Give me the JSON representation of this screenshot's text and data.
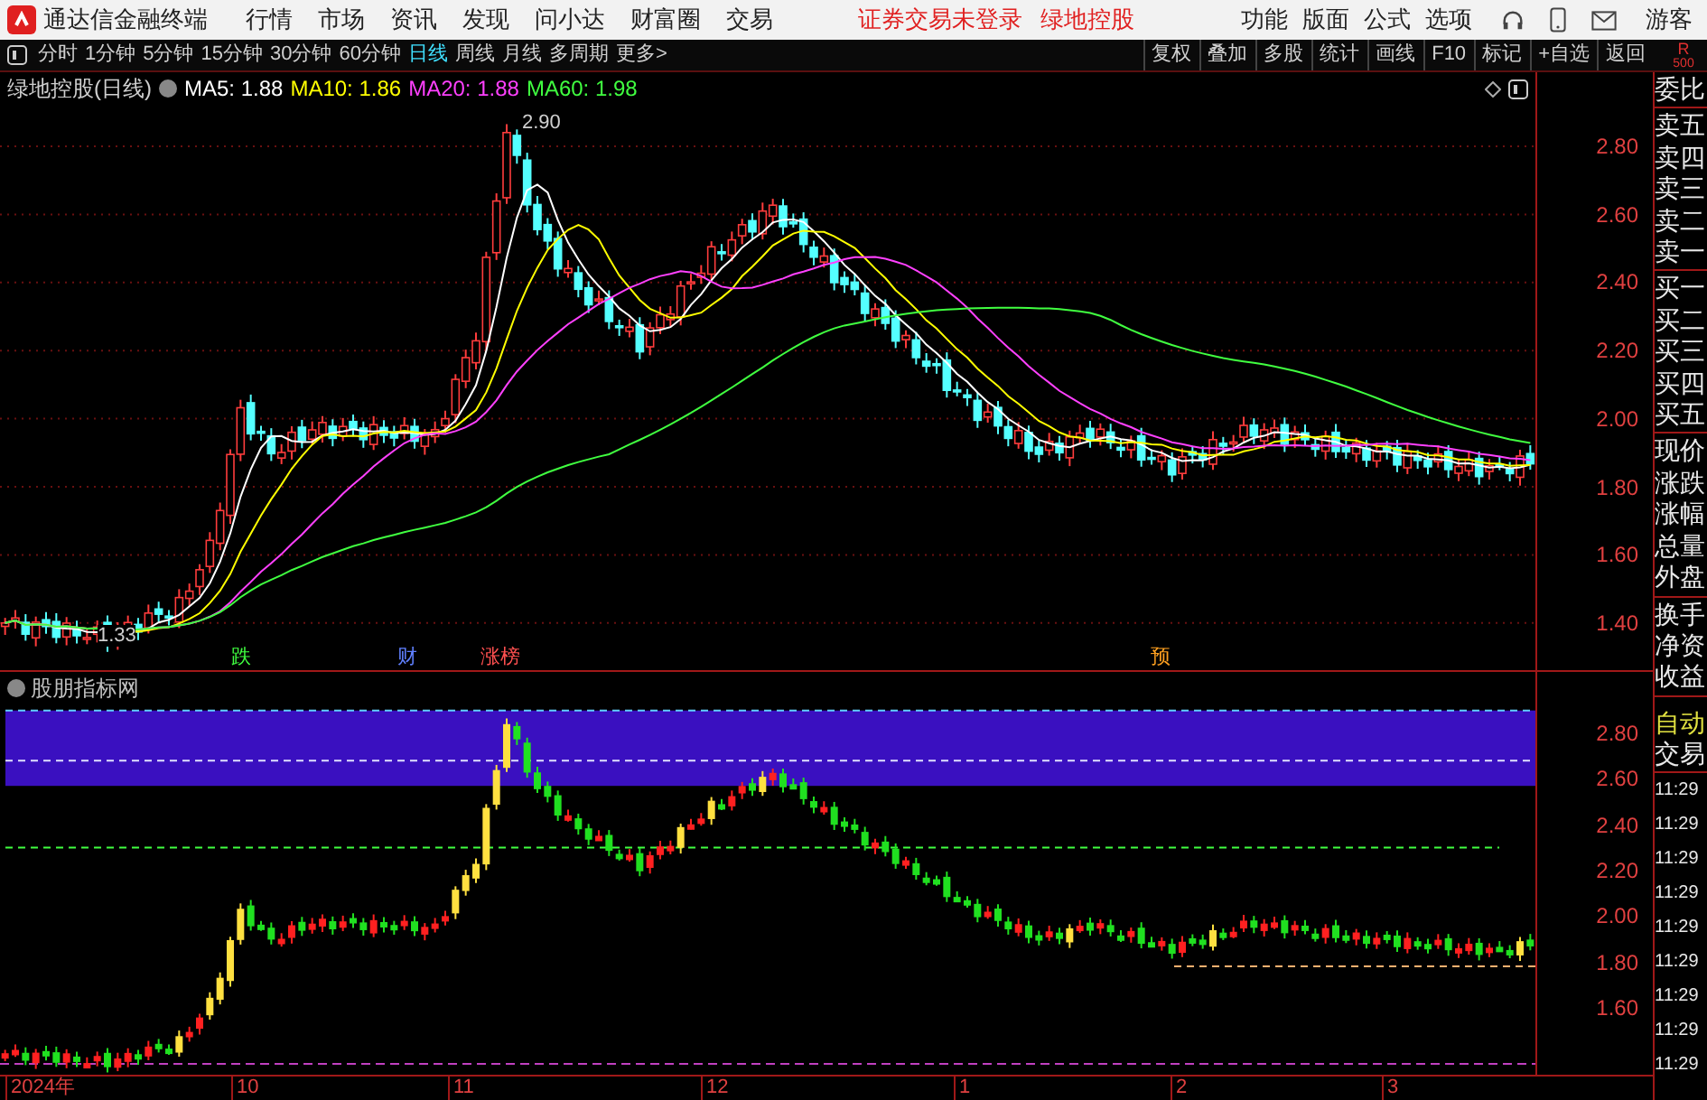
{
  "title_bar": {
    "app_name": "通达信金融终端",
    "menus": [
      "行情",
      "市场",
      "资讯",
      "发现",
      "问小达",
      "财富圈",
      "交易"
    ],
    "notices": [
      "证券交易未登录",
      "绿地控股"
    ],
    "tools": [
      "功能",
      "版面",
      "公式",
      "选项"
    ],
    "user": "游客"
  },
  "toolbar": {
    "periods": [
      {
        "label": "分时",
        "selected": false
      },
      {
        "label": "1分钟",
        "selected": false
      },
      {
        "label": "5分钟",
        "selected": false
      },
      {
        "label": "15分钟",
        "selected": false
      },
      {
        "label": "30分钟",
        "selected": false
      },
      {
        "label": "60分钟",
        "selected": false
      },
      {
        "label": "日线",
        "selected": true
      },
      {
        "label": "周线",
        "selected": false
      },
      {
        "label": "月线",
        "selected": false
      },
      {
        "label": "多周期",
        "selected": false
      },
      {
        "label": "更多>",
        "selected": false
      }
    ],
    "actions": [
      "复权",
      "叠加",
      "多股",
      "统计",
      "画线",
      "F10",
      "标记",
      "+自选",
      "返回"
    ],
    "corner": [
      "R",
      "500"
    ]
  },
  "main_chart": {
    "title": "绿地控股(日线)",
    "moving_averages": [
      {
        "label": "MA5: 1.88",
        "color": "#ffffff"
      },
      {
        "label": "MA10: 1.86",
        "color": "#ffff00"
      },
      {
        "label": "MA20: 1.88",
        "color": "#ff40ff"
      },
      {
        "label": "MA60: 1.98",
        "color": "#40ff40"
      }
    ],
    "y_ticks": [
      "2.80",
      "2.60",
      "2.40",
      "2.20",
      "2.00",
      "1.80",
      "1.60",
      "1.40"
    ],
    "high_label": "2.90",
    "low_label": "1.33",
    "markers": [
      {
        "text": "跌",
        "color": "#40ff40"
      },
      {
        "text": "财",
        "color": "#6080ff"
      },
      {
        "text": "涨榜",
        "color": "#ff5050"
      },
      {
        "text": "预",
        "color": "#ffa020"
      }
    ]
  },
  "indicator_chart": {
    "title": "股朋指标网",
    "y_ticks": [
      "2.80",
      "2.60",
      "2.40",
      "2.20",
      "2.00",
      "1.80",
      "1.60"
    ]
  },
  "x_axis": [
    "2024年",
    "10",
    "11",
    "12",
    "1",
    "2",
    "3"
  ],
  "quote_panel": {
    "groups": [
      [
        "委比"
      ],
      [
        "卖五",
        "卖四",
        "卖三",
        "卖二",
        "卖一"
      ],
      [
        "买一",
        "买二",
        "买三",
        "买四",
        "买五"
      ],
      [
        "现价",
        "涨跌",
        "涨幅",
        "总量",
        "外盘"
      ],
      [
        "换手",
        "净资",
        "收益"
      ]
    ]
  },
  "trade_panel": {
    "mode": "自动",
    "title": "交易",
    "times": [
      "11:29",
      "11:29",
      "11:29",
      "11:29",
      "11:29",
      "11:29",
      "11:29",
      "11:29",
      "11:29"
    ]
  }
}
